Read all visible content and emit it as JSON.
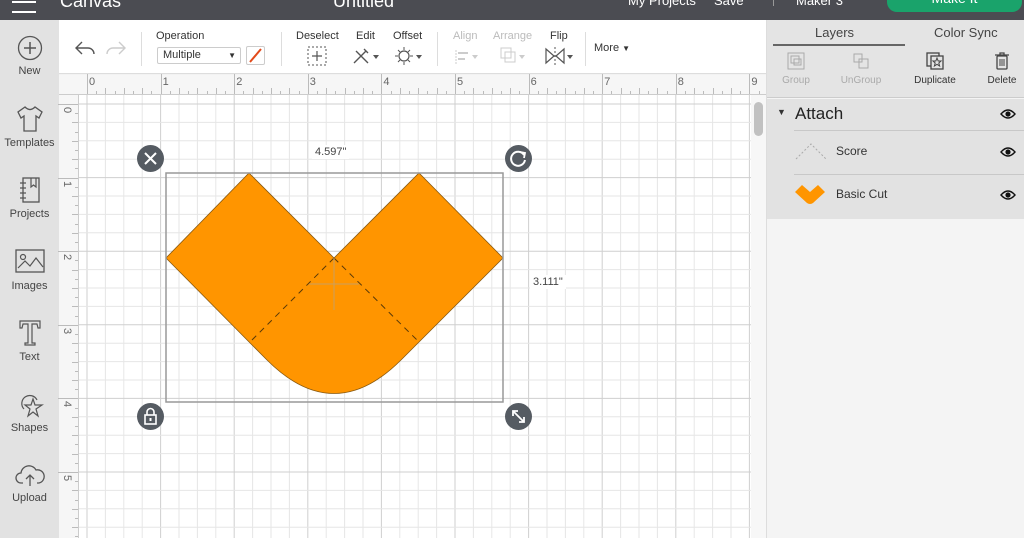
{
  "header": {
    "app_title": "Canvas",
    "doc_title": "Untitled",
    "nav": [
      "My Projects",
      "Save"
    ],
    "machine": "Maker 3",
    "make_it_label": "Make It",
    "make_it_color": "#1aa36b"
  },
  "sidebar": {
    "items": [
      {
        "label": "New",
        "icon": "plus-circle-icon"
      },
      {
        "label": "Templates",
        "icon": "tshirt-icon"
      },
      {
        "label": "Projects",
        "icon": "notebook-icon"
      },
      {
        "label": "Images",
        "icon": "image-icon"
      },
      {
        "label": "Text",
        "icon": "text-t-icon"
      },
      {
        "label": "Shapes",
        "icon": "shapes-icon"
      },
      {
        "label": "Upload",
        "icon": "cloud-upload-icon"
      }
    ]
  },
  "toolbar": {
    "undo_icon": "undo-icon",
    "redo_icon": "redo-icon",
    "operation_label": "Operation",
    "operation_value": "Multiple",
    "deselect_label": "Deselect",
    "edit_label": "Edit",
    "offset_label": "Offset",
    "align_label": "Align",
    "arrange_label": "Arrange",
    "flip_label": "Flip",
    "more_label": "More"
  },
  "rulers": {
    "horizontal": [
      "0",
      "1",
      "2",
      "3",
      "4",
      "5",
      "6",
      "7",
      "8",
      "9"
    ],
    "vertical": [
      "0",
      "1",
      "2",
      "3",
      "4",
      "5"
    ]
  },
  "canvas": {
    "selection": {
      "width_label": "4.597\"",
      "height_label": "3.111\""
    },
    "shape_color": "#ff9500"
  },
  "panel": {
    "tabs": [
      "Layers",
      "Color Sync"
    ],
    "active_tab": "Layers",
    "actions": [
      {
        "label": "Group",
        "enabled": false
      },
      {
        "label": "UnGroup",
        "enabled": false
      },
      {
        "label": "Duplicate",
        "enabled": true
      },
      {
        "label": "Delete",
        "enabled": true
      }
    ],
    "group": {
      "name": "Attach",
      "expanded": true
    },
    "layers": [
      {
        "name": "Score",
        "type": "score",
        "visible": true
      },
      {
        "name": "Basic Cut",
        "type": "cut",
        "visible": true
      }
    ]
  }
}
